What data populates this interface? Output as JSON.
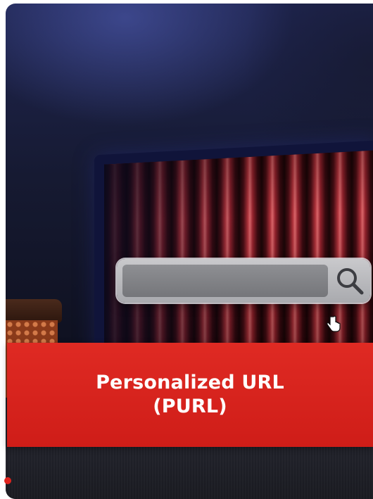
{
  "card": {
    "title": "Personalized URL\n(PURL)",
    "image_icons": [
      "search-icon",
      "hand-cursor-icon"
    ],
    "accent_color": "#d9241e"
  },
  "carousel": {
    "indicator_color": "#e0241e"
  }
}
